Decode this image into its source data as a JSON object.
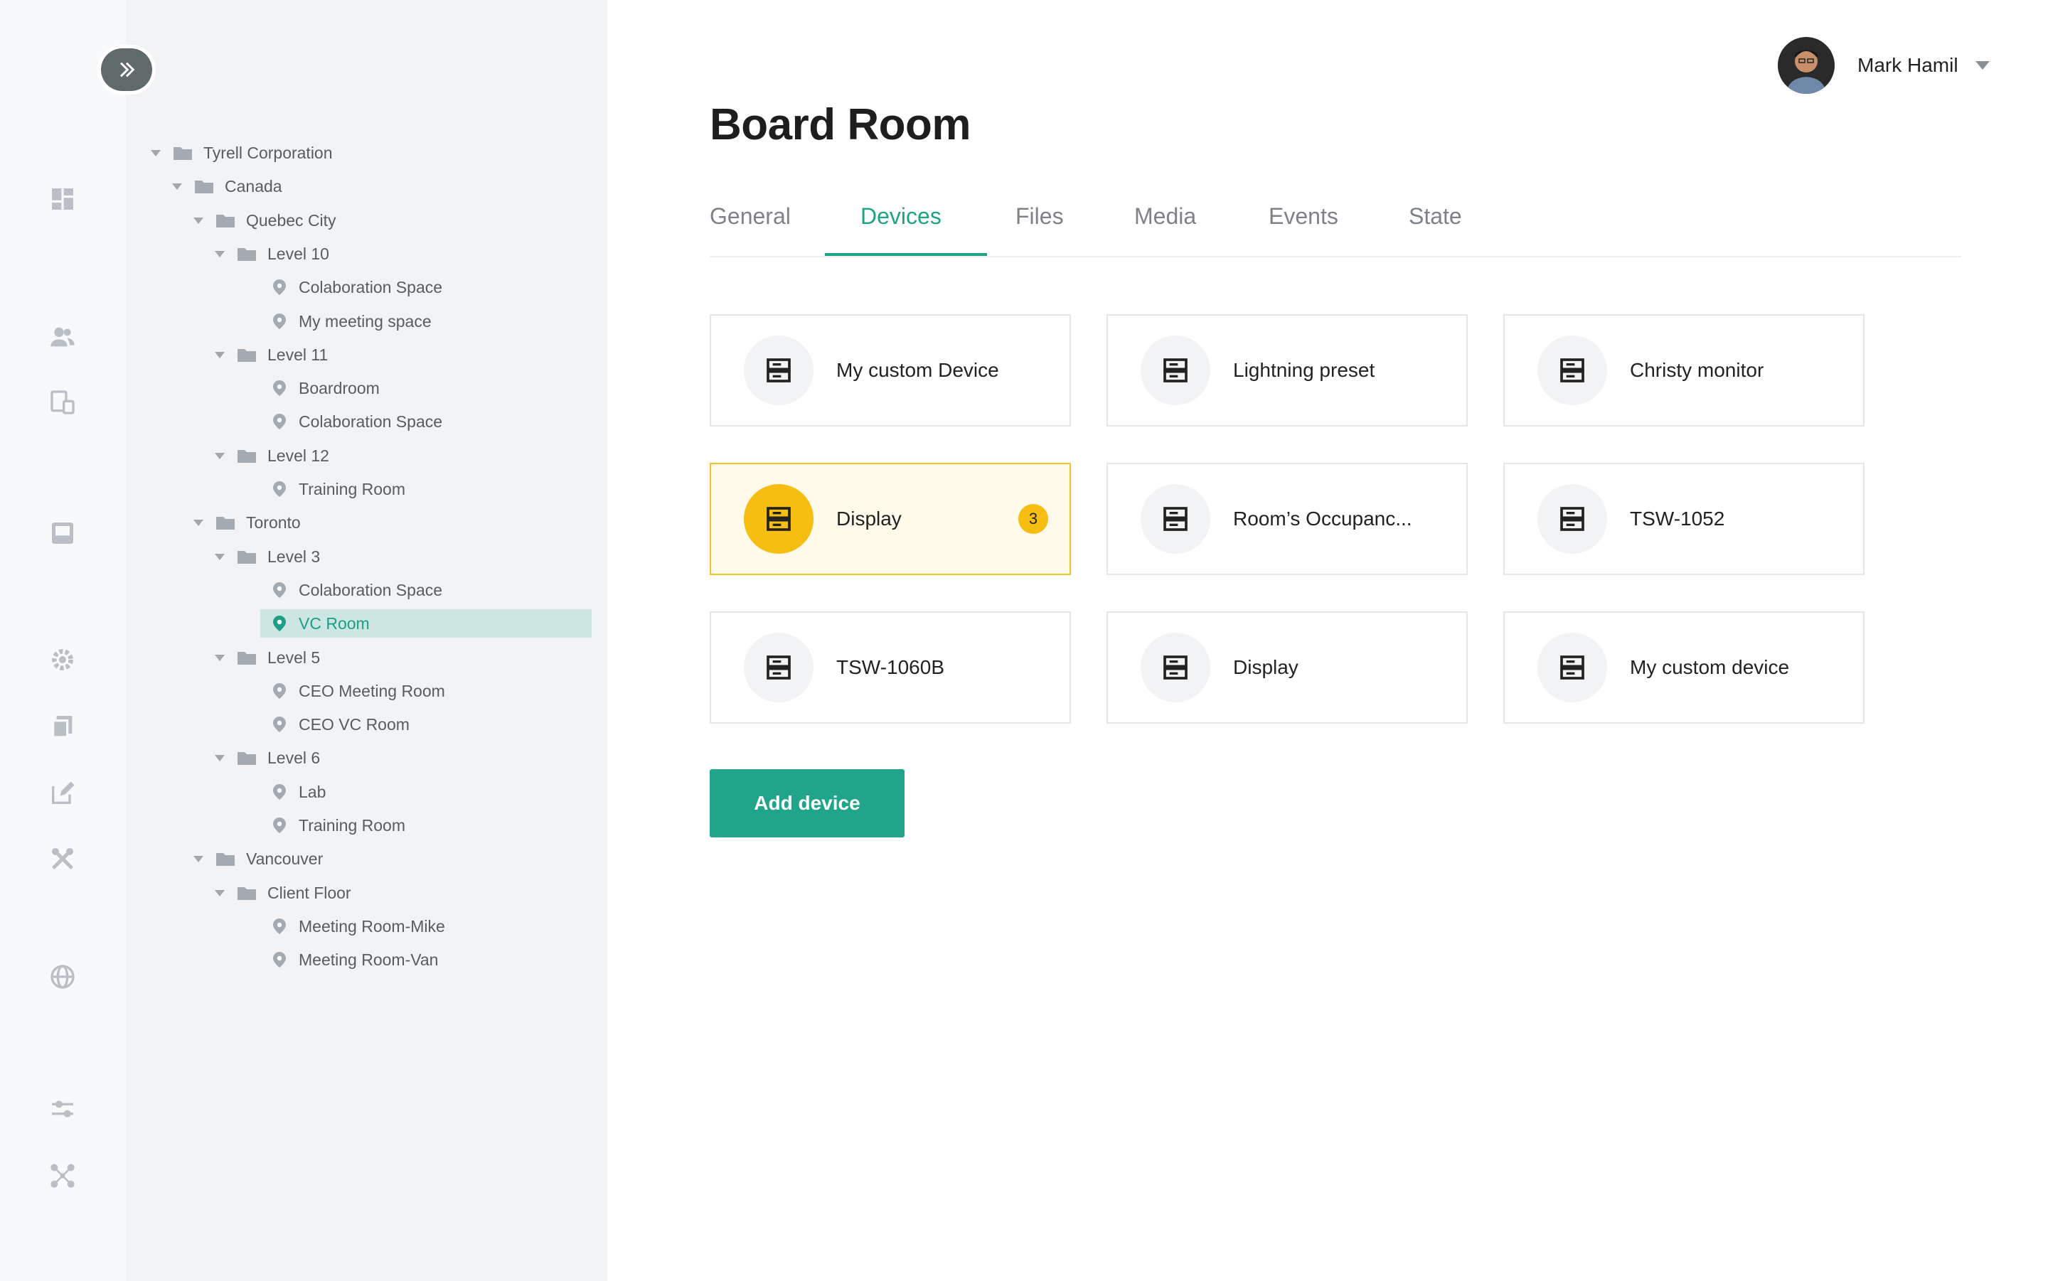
{
  "user": {
    "name": "Mark Hamil"
  },
  "page": {
    "title": "Board Room"
  },
  "tabs": [
    {
      "label": "General"
    },
    {
      "label": "Devices",
      "active": true
    },
    {
      "label": "Files"
    },
    {
      "label": "Media"
    },
    {
      "label": "Events"
    },
    {
      "label": "State"
    }
  ],
  "rail_icons": [
    "dashboard-icon",
    "users-icon",
    "devices-icon",
    "inbox-icon",
    "settings-icon",
    "copy-icon",
    "edit-icon",
    "tools-icon",
    "globe-icon",
    "sliders-icon",
    "network-icon"
  ],
  "tree": [
    {
      "label": "Tyrell Corporation",
      "type": "folder",
      "depth": 0
    },
    {
      "label": "Canada",
      "type": "folder",
      "depth": 1
    },
    {
      "label": "Quebec City",
      "type": "folder",
      "depth": 2
    },
    {
      "label": "Level 10",
      "type": "folder",
      "depth": 3
    },
    {
      "label": "Colaboration Space",
      "type": "room",
      "depth": 4
    },
    {
      "label": "My meeting space",
      "type": "room",
      "depth": 4
    },
    {
      "label": "Level 11",
      "type": "folder",
      "depth": 3
    },
    {
      "label": "Boardroom",
      "type": "room",
      "depth": 4
    },
    {
      "label": "Colaboration Space",
      "type": "room",
      "depth": 4
    },
    {
      "label": "Level 12",
      "type": "folder",
      "depth": 3
    },
    {
      "label": "Training Room",
      "type": "room",
      "depth": 4
    },
    {
      "label": "Toronto",
      "type": "folder",
      "depth": 2
    },
    {
      "label": "Level 3",
      "type": "folder",
      "depth": 3
    },
    {
      "label": "Colaboration Space",
      "type": "room",
      "depth": 4
    },
    {
      "label": "VC Room",
      "type": "room",
      "depth": 4,
      "selected": true
    },
    {
      "label": "Level 5",
      "type": "folder",
      "depth": 3
    },
    {
      "label": "CEO Meeting Room",
      "type": "room",
      "depth": 4
    },
    {
      "label": "CEO VC Room",
      "type": "room",
      "depth": 4
    },
    {
      "label": "Level 6",
      "type": "folder",
      "depth": 3
    },
    {
      "label": "Lab",
      "type": "room",
      "depth": 4
    },
    {
      "label": "Training Room",
      "type": "room",
      "depth": 4
    },
    {
      "label": "Vancouver",
      "type": "folder",
      "depth": 2
    },
    {
      "label": "Client Floor",
      "type": "folder",
      "depth": 3
    },
    {
      "label": "Meeting Room-Mike",
      "type": "room",
      "depth": 4
    },
    {
      "label": "Meeting Room-Van",
      "type": "room",
      "depth": 4
    }
  ],
  "devices": [
    {
      "label": "My custom Device"
    },
    {
      "label": "Lightning preset"
    },
    {
      "label": "Christy monitor"
    },
    {
      "label": "Display",
      "active": true,
      "badge": "3"
    },
    {
      "label": "Room’s Occupanc..."
    },
    {
      "label": "TSW-1052"
    },
    {
      "label": "TSW-1060B"
    },
    {
      "label": "Display"
    },
    {
      "label": "My custom device"
    }
  ],
  "actions": {
    "add_device": "Add device"
  },
  "colors": {
    "accent": "#1ea385",
    "highlight": "#f7be12",
    "selected_bg": "#cde6e1"
  }
}
